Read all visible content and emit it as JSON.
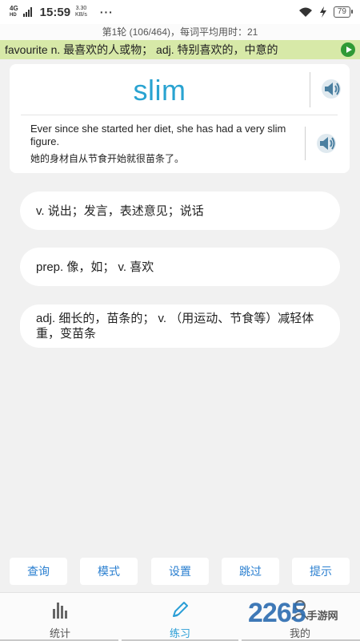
{
  "status_bar": {
    "network": "4G",
    "network_sub": "HD",
    "time": "15:59",
    "speed_value": "3.30",
    "speed_unit": "KB/s",
    "more": "···",
    "battery": "79",
    "icons": [
      "signal-icon",
      "wifi-icon",
      "charging-icon",
      "battery-icon"
    ]
  },
  "progress": {
    "text": "第1轮 (106/464)，每词平均用时：21"
  },
  "ticker": {
    "text": "favourite n. 最喜欢的人或物；  adj. 特别喜欢的，中意的",
    "color": "#d7e9a8",
    "play_color": "#2f9a35"
  },
  "word_card": {
    "word": "slim",
    "word_color": "#29a3d1",
    "example_en": "Ever since she started her diet, she has had a very slim figure.",
    "example_zh": "她的身材自从节食开始就很苗条了。"
  },
  "options": [
    "v. 说出；发言，表述意见；说话",
    "prep. 像，如；  v. 喜欢",
    "adj. 细长的，苗条的；  v. （用运动、节食等）减轻体重，变苗条"
  ],
  "toolbar": {
    "buttons": [
      "查询",
      "模式",
      "设置",
      "跳过",
      "提示"
    ],
    "text_color": "#2a7fd0"
  },
  "nav": {
    "items": [
      {
        "label": "统计",
        "icon": "bar-chart-icon"
      },
      {
        "label": "练习",
        "icon": "pencil-icon"
      },
      {
        "label": "我的",
        "icon": "user-icon"
      }
    ],
    "active_index": 1,
    "active_color": "#2a9ed6"
  },
  "watermark": {
    "number": "2265",
    "text": "手游网"
  }
}
